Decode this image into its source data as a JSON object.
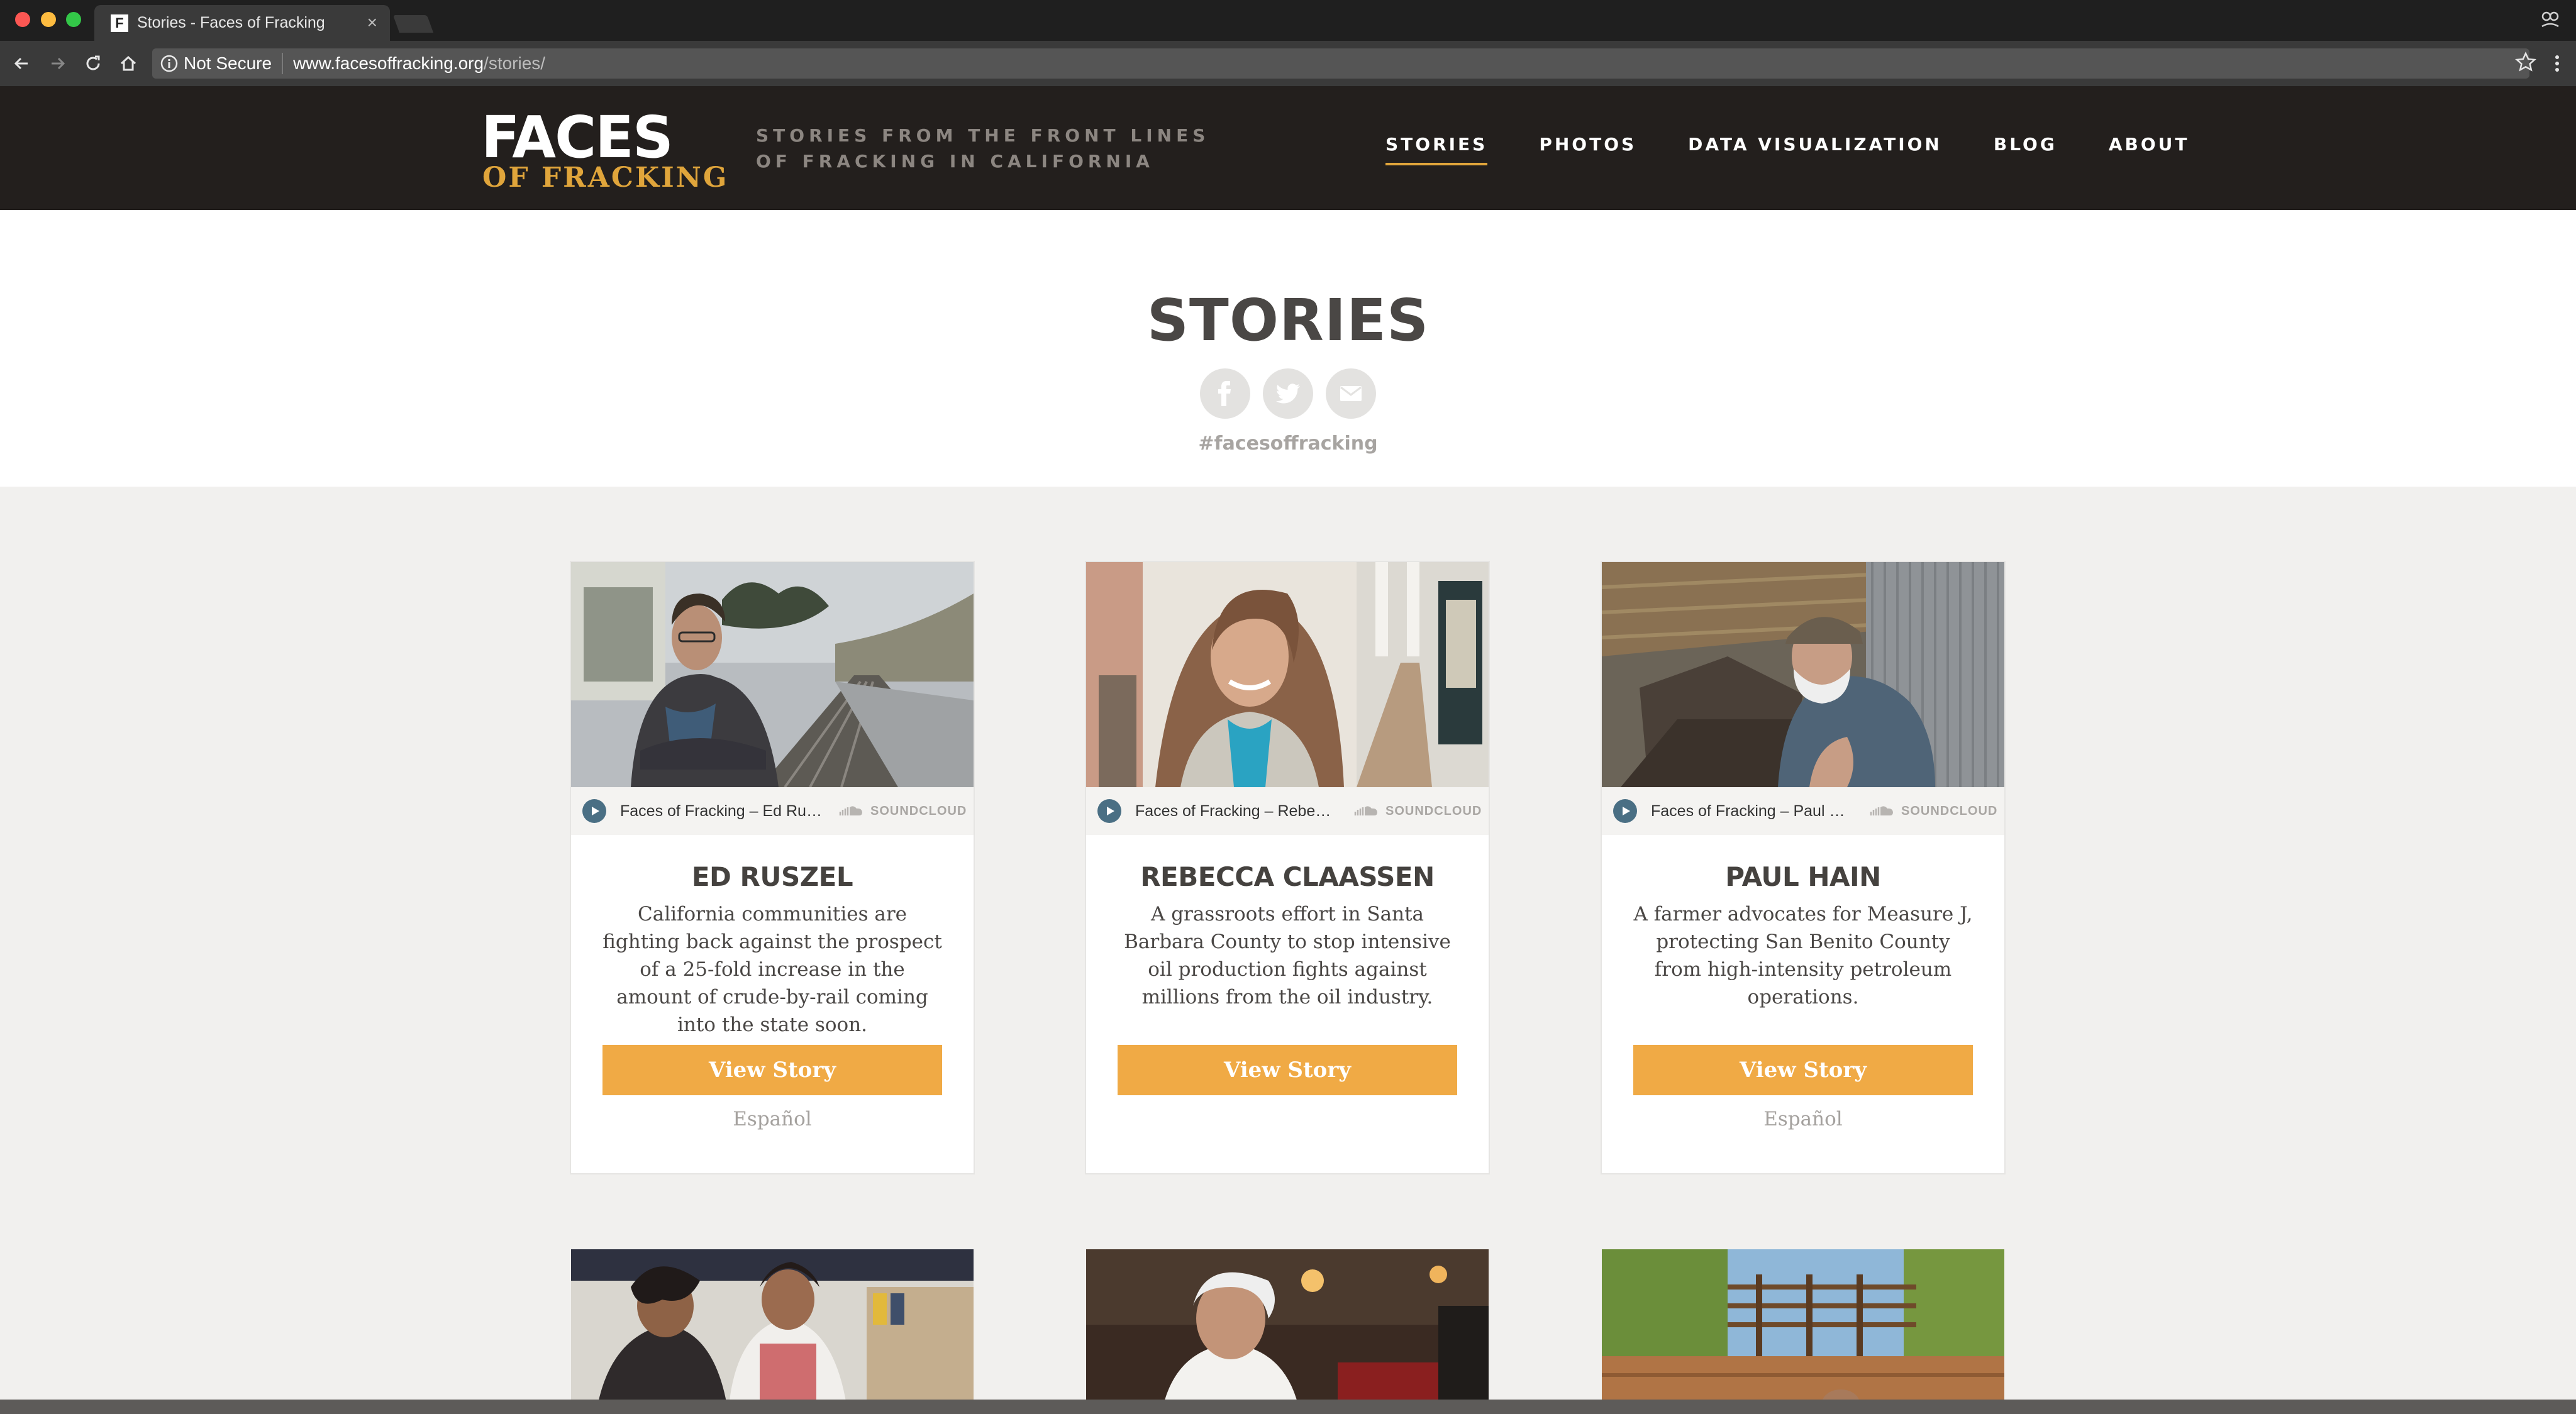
{
  "browser": {
    "tab_title": "Stories - Faces of Fracking",
    "tab_close": "×",
    "not_secure": "Not Secure",
    "url_host": "www.facesoffracking.org",
    "url_path": "/stories/"
  },
  "site": {
    "logo_main": "FACES",
    "logo_sub": "OF FRACKING",
    "tagline_line1": "STORIES FROM THE FRONT LINES",
    "tagline_line2": "OF FRACKING IN CALIFORNIA",
    "nav": [
      "STORIES",
      "PHOTOS",
      "DATA VISUALIZATION",
      "BLOG",
      "ABOUT"
    ],
    "active_nav": "STORIES"
  },
  "hero": {
    "title": "STORIES",
    "hashtag": "#facesoffracking"
  },
  "cards": [
    {
      "track": "Faces of Fracking – Ed Ru…",
      "soundcloud": "SOUNDCLOUD",
      "name": "ED RUSZEL",
      "desc": "California communities are fighting back against the prospect of a 25-fold increase in the amount of crude-by-rail coming into the state soon.",
      "button": "View Story",
      "espanol": "Español"
    },
    {
      "track": "Faces of Fracking – Rebe…",
      "soundcloud": "SOUNDCLOUD",
      "name": "REBECCA CLAASSEN",
      "desc": "A grassroots effort in Santa Barbara County to stop intensive oil production fights against millions from the oil industry.",
      "button": "View Story",
      "espanol": ""
    },
    {
      "track": "Faces of Fracking – Paul …",
      "soundcloud": "SOUNDCLOUD",
      "name": "PAUL HAIN",
      "desc": "A farmer advocates for Measure J, protecting San Benito County from high-intensity petroleum operations.",
      "button": "View Story",
      "espanol": "Español"
    }
  ],
  "colors": {
    "header_bg": "#231f1d",
    "accent": "#e0a53b",
    "button": "#f0aa45",
    "page_bg": "#f1f0ee"
  }
}
